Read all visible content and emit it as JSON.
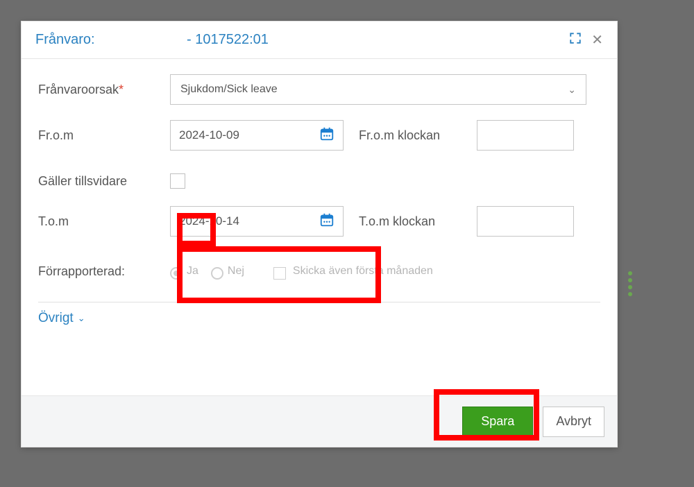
{
  "header": {
    "title_prefix": "Frånvaro:",
    "title_id": "- 1017522:01"
  },
  "form": {
    "reason_label": "Frånvaroorsak",
    "reason_value": "Sjukdom/Sick leave",
    "from_label": "Fr.o.m",
    "from_date": "2024-10-09",
    "from_time_label": "Fr.o.m klockan",
    "from_time": "",
    "ongoing_label": "Gäller tillsvidare",
    "ongoing_checked": false,
    "to_label": "T.o.m",
    "to_date": "2024-10-14",
    "to_time_label": "T.o.m klockan",
    "to_time": "",
    "prereported_label": "Förrapporterad:",
    "prereported_yes": "Ja",
    "prereported_no": "Nej",
    "send_first_month_label": "Skicka även första månaden"
  },
  "collapse": {
    "ovrigt": "Övrigt"
  },
  "footer": {
    "save": "Spara",
    "cancel": "Avbryt"
  }
}
